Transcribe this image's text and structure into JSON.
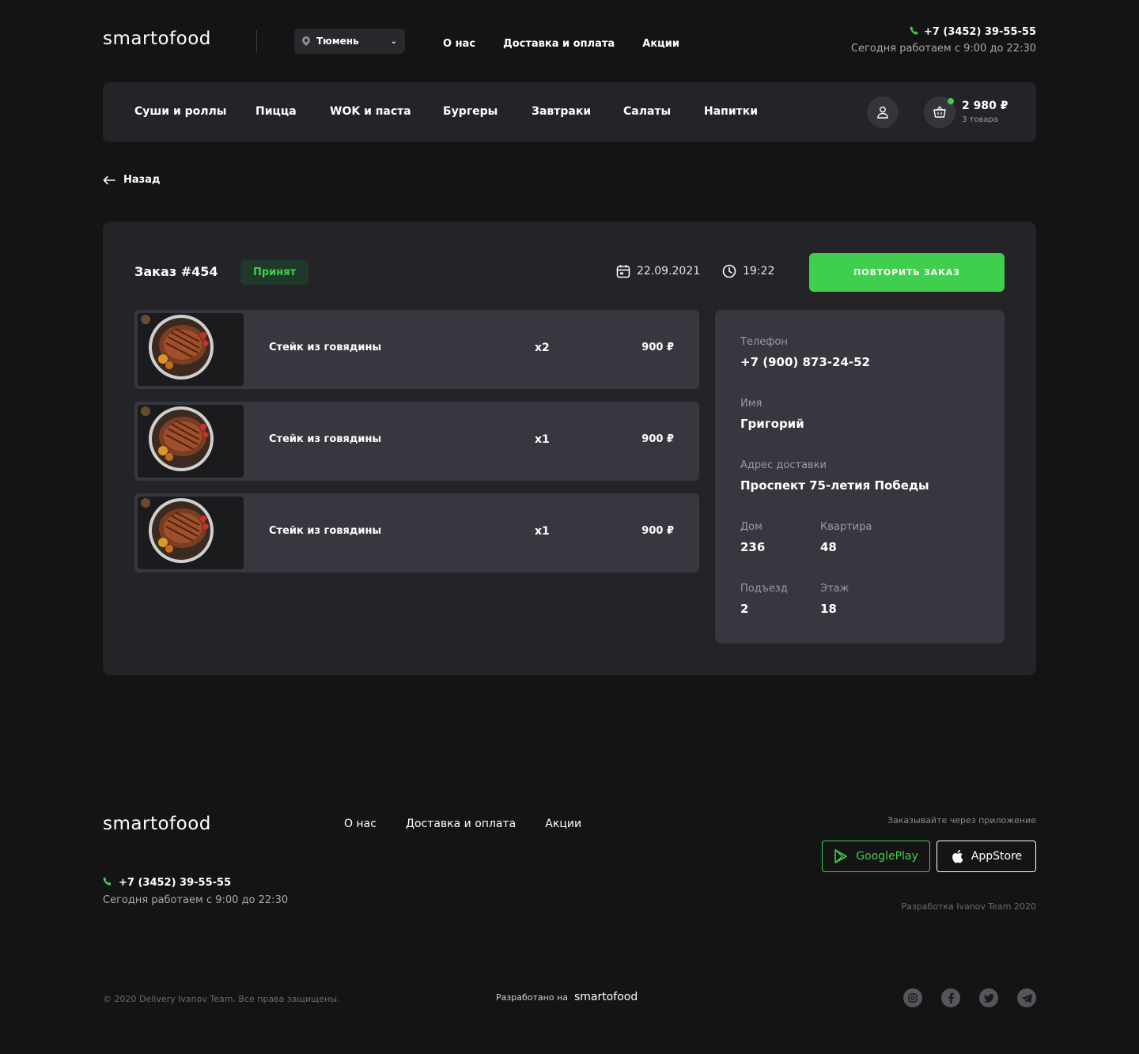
{
  "header": {
    "logo": "smartofood",
    "city": "Тюмень",
    "nav": [
      "О нас",
      "Доставка и оплата",
      "Акции"
    ],
    "phone": "+7 (3452) 39-55-55",
    "hours": "Сегодня работаем с 9:00 до 22:30"
  },
  "categories": [
    "Суши и роллы",
    "Пицца",
    "WOK и паста",
    "Бургеры",
    "Завтраки",
    "Салаты",
    "Напитки"
  ],
  "cart": {
    "total": "2 980 ₽",
    "count": "3 товара"
  },
  "back_label": "Назад",
  "order": {
    "title": "Заказ #454",
    "status": "Принят",
    "date": "22.09.2021",
    "time": "19:22",
    "repeat_label": "ПОВТОРИТЬ ЗАКАЗ",
    "items": [
      {
        "name": "Стейк из говядины",
        "qty": "x2",
        "price": "900 ₽"
      },
      {
        "name": "Стейк из говядины",
        "qty": "x1",
        "price": "900 ₽"
      },
      {
        "name": "Стейк из говядины",
        "qty": "x1",
        "price": "900 ₽"
      }
    ]
  },
  "details": {
    "phone_label": "Телефон",
    "phone": "+7 (900) 873-24-52",
    "name_label": "Имя",
    "name": "Григорий",
    "address_label": "Адрес доставки",
    "address": "Проспект 75-летия Победы",
    "house_label": "Дом",
    "house": "236",
    "flat_label": "Квартира",
    "flat": "48",
    "entrance_label": "Подъезд",
    "entrance": "2",
    "floor_label": "Этаж",
    "floor": "18"
  },
  "footer": {
    "logo": "smartofood",
    "nav": [
      "О нас",
      "Доставка и оплата",
      "Акции"
    ],
    "phone": "+7 (3452) 39-55-55",
    "hours": "Сегодня работаем с 9:00 до 22:30",
    "app_label": "Заказывайте через приложение",
    "googleplay": "GooglePlay",
    "appstore": "AppStore",
    "dev": "Разработка Ivanov Team 2020",
    "copyright": "© 2020 Delivery Ivanov Team. Все права защищены.",
    "made_on": "Разработано на",
    "made_on_logo": "smartofood",
    "social_icons": [
      "instagram-icon",
      "facebook-icon",
      "twitter-icon",
      "telegram-icon"
    ]
  },
  "colors": {
    "accent": "#3fce4d",
    "background": "#141415",
    "panel": "#232328",
    "card": "#37373f"
  }
}
